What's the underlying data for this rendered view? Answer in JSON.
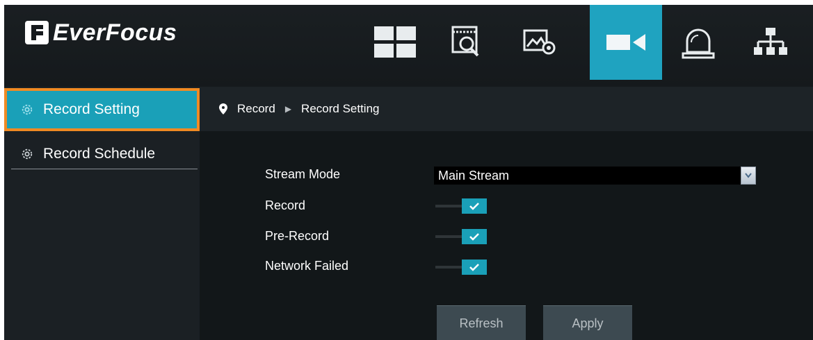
{
  "app": {
    "brand": "EverFocus"
  },
  "topnav": {
    "items": [
      {
        "name": "live-view",
        "icon": "grid-view-icon"
      },
      {
        "name": "playback",
        "icon": "playback-search-icon"
      },
      {
        "name": "image-settings",
        "icon": "image-settings-icon"
      },
      {
        "name": "record",
        "icon": "video-camera-icon",
        "active": true
      },
      {
        "name": "alarm",
        "icon": "alarm-bell-icon"
      },
      {
        "name": "network",
        "icon": "network-icon"
      }
    ],
    "active_color": "#1fa3c0"
  },
  "sidebar": {
    "items": [
      {
        "label": "Record Setting",
        "icon": "gear-icon",
        "selected": true
      },
      {
        "label": "Record Schedule",
        "icon": "gear-icon",
        "selected": false
      }
    ],
    "highlight_color": "#f08a23"
  },
  "breadcrumb": {
    "items": [
      "Record",
      "Record Setting"
    ]
  },
  "form": {
    "stream_mode_label": "Stream Mode",
    "stream_mode_value": "Main Stream",
    "record_label": "Record",
    "record_on": true,
    "pre_record_label": "Pre-Record",
    "pre_record_on": true,
    "network_failed_label": "Network Failed",
    "network_failed_on": true
  },
  "buttons": {
    "refresh": "Refresh",
    "apply": "Apply"
  }
}
